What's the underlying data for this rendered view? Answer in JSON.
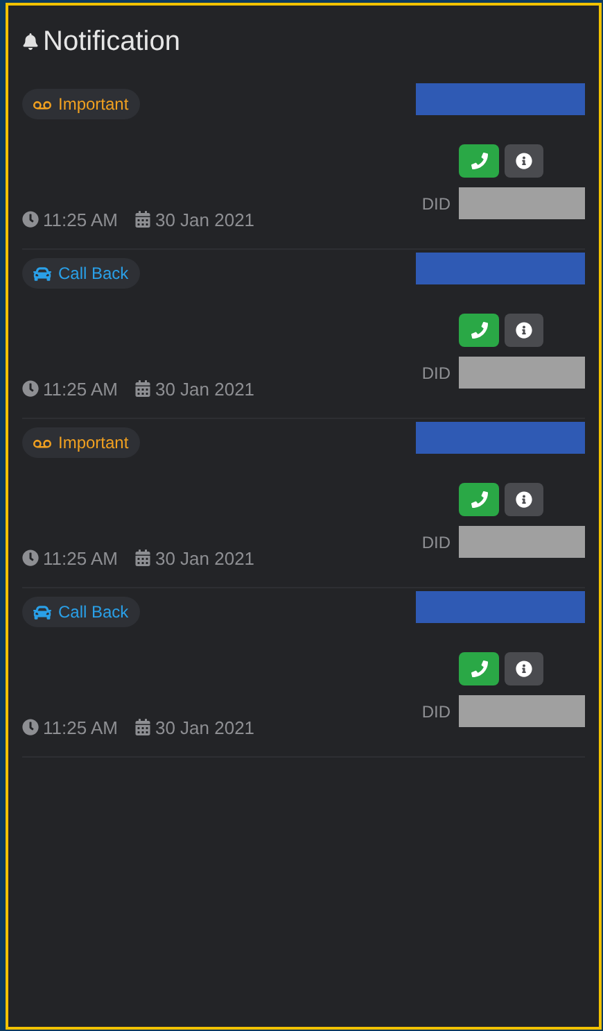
{
  "title": "Notification",
  "notifications": [
    {
      "tag": {
        "kind": "important",
        "label": "Important"
      },
      "time": "11:25 AM",
      "date": "30 Jan 2021",
      "did_label": "DID"
    },
    {
      "tag": {
        "kind": "callback",
        "label": "Call Back"
      },
      "time": "11:25 AM",
      "date": "30 Jan 2021",
      "did_label": "DID"
    },
    {
      "tag": {
        "kind": "important",
        "label": "Important"
      },
      "time": "11:25 AM",
      "date": "30 Jan 2021",
      "did_label": "DID"
    },
    {
      "tag": {
        "kind": "callback",
        "label": "Call Back"
      },
      "time": "11:25 AM",
      "date": "30 Jan 2021",
      "did_label": "DID"
    }
  ]
}
